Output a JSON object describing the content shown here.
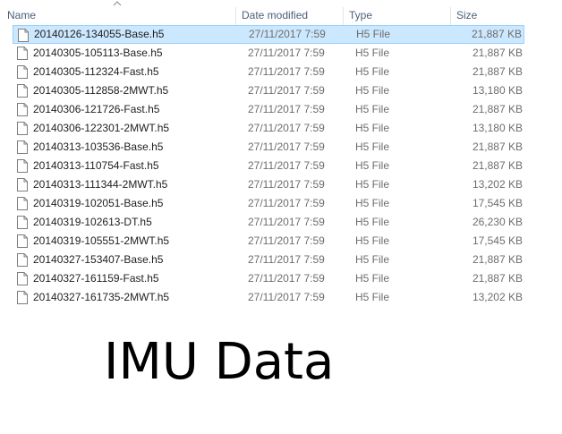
{
  "columns": {
    "name": "Name",
    "date_modified": "Date modified",
    "type": "Type",
    "size": "Size",
    "sort_column": "name",
    "sort_direction": "ascending"
  },
  "selected_index": 0,
  "files": [
    {
      "name": "20140126-134055-Base.h5",
      "date": "27/11/2017 7:59",
      "type": "H5 File",
      "size": "21,887 KB"
    },
    {
      "name": "20140305-105113-Base.h5",
      "date": "27/11/2017 7:59",
      "type": "H5 File",
      "size": "21,887 KB"
    },
    {
      "name": "20140305-112324-Fast.h5",
      "date": "27/11/2017 7:59",
      "type": "H5 File",
      "size": "21,887 KB"
    },
    {
      "name": "20140305-112858-2MWT.h5",
      "date": "27/11/2017 7:59",
      "type": "H5 File",
      "size": "13,180 KB"
    },
    {
      "name": "20140306-121726-Fast.h5",
      "date": "27/11/2017 7:59",
      "type": "H5 File",
      "size": "21,887 KB"
    },
    {
      "name": "20140306-122301-2MWT.h5",
      "date": "27/11/2017 7:59",
      "type": "H5 File",
      "size": "13,180 KB"
    },
    {
      "name": "20140313-103536-Base.h5",
      "date": "27/11/2017 7:59",
      "type": "H5 File",
      "size": "21,887 KB"
    },
    {
      "name": "20140313-110754-Fast.h5",
      "date": "27/11/2017 7:59",
      "type": "H5 File",
      "size": "21,887 KB"
    },
    {
      "name": "20140313-111344-2MWT.h5",
      "date": "27/11/2017 7:59",
      "type": "H5 File",
      "size": "13,202 KB"
    },
    {
      "name": "20140319-102051-Base.h5",
      "date": "27/11/2017 7:59",
      "type": "H5 File",
      "size": "17,545 KB"
    },
    {
      "name": "20140319-102613-DT.h5",
      "date": "27/11/2017 7:59",
      "type": "H5 File",
      "size": "26,230 KB"
    },
    {
      "name": "20140319-105551-2MWT.h5",
      "date": "27/11/2017 7:59",
      "type": "H5 File",
      "size": "17,545 KB"
    },
    {
      "name": "20140327-153407-Base.h5",
      "date": "27/11/2017 7:59",
      "type": "H5 File",
      "size": "21,887 KB"
    },
    {
      "name": "20140327-161159-Fast.h5",
      "date": "27/11/2017 7:59",
      "type": "H5 File",
      "size": "21,887 KB"
    },
    {
      "name": "20140327-161735-2MWT.h5",
      "date": "27/11/2017 7:59",
      "type": "H5 File",
      "size": "13,202 KB"
    }
  ],
  "file_icon": "file-icon",
  "caption": "IMU Data",
  "colors": {
    "selection_bg": "#cce8ff",
    "selection_border": "#99d1ff",
    "header_text": "#4c607a",
    "secondary_text": "#6d6d6d"
  }
}
